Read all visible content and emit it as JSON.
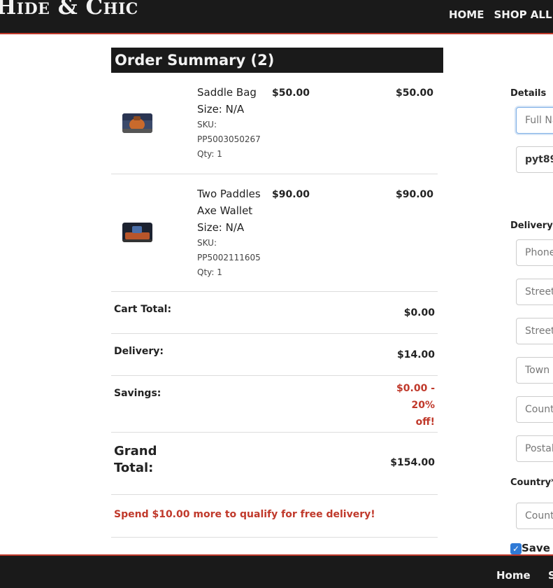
{
  "header": {
    "logo": "Hide & Chic",
    "nav": [
      "HOME",
      "SHOP ALL"
    ]
  },
  "summary": {
    "title": "Order Summary (2)",
    "items": [
      {
        "name_lines": [
          "Saddle Bag"
        ],
        "size": "Size: N/A",
        "sku_label": "SKU:",
        "sku": "PP5003050267",
        "qty": "Qty: 1",
        "unit_price": "$50.00",
        "total_price": "$50.00",
        "image_icon": "saddle-bag-image"
      },
      {
        "name_lines": [
          "Two Paddles",
          "Axe Wallet"
        ],
        "size": "Size: N/A",
        "sku_label": "SKU:",
        "sku": "PP5002111605",
        "qty": "Qty: 1",
        "unit_price": "$90.00",
        "total_price": "$90.00",
        "image_icon": "axe-wallet-image"
      }
    ],
    "cart_total_label": "Cart Total:",
    "cart_total_value": "$0.00",
    "delivery_label": "Delivery:",
    "delivery_value": "$14.00",
    "savings_label": "Savings:",
    "savings_value_lines": [
      "$0.00 -",
      "20%",
      "off!"
    ],
    "grand_total_lines": [
      "Grand",
      "Total:"
    ],
    "grand_total_value": "$154.00",
    "promo": "Spend $10.00 more to qualify for free delivery!"
  },
  "form": {
    "details_label": "Details",
    "full_name_placeholder": "Full Name",
    "email_value": "pyt89",
    "delivery_label": "Delivery",
    "phone_placeholder": "Phone",
    "street1_placeholder": "Street",
    "street2_placeholder": "Street",
    "town_placeholder": "Town",
    "county_placeholder": "Count",
    "postal_placeholder": "Postal",
    "country_label": "Country*",
    "country_placeholder": "Count",
    "save_label": "Save t",
    "save_checked": true
  },
  "footer": {
    "links": [
      "Home",
      "S"
    ]
  },
  "colors": {
    "dark": "#1a1a1a",
    "accent": "#c0392b",
    "check_blue": "#2f7ad6"
  }
}
